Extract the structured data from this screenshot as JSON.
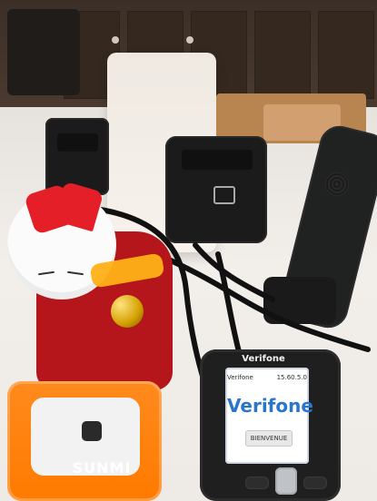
{
  "scene": {
    "devices": {
      "verifone": {
        "brand_top": "Verifone",
        "status_left": "Verifone",
        "status_right": "15.60.5.0",
        "logo": "Verifone",
        "button": "BIENVENUE"
      },
      "scanner": {
        "brand": "SUNMI"
      }
    }
  }
}
